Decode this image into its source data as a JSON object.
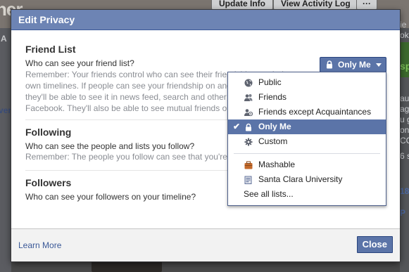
{
  "background": {
    "cover_title_fragment": "ner",
    "update_info_button": "Update Info",
    "activity_log_button": "View Activity Log",
    "more_button": "···",
    "left_fragment_a": "A",
    "left_fragment_ver": "ver",
    "right_fragments": [
      "ie",
      "ok.c",
      "sp",
      "aus",
      "ag",
      "u g",
      "ons",
      "CC",
      "6 s",
      "18",
      "P"
    ]
  },
  "dialog": {
    "title": "Edit Privacy",
    "sections": {
      "friend_list": {
        "heading": "Friend List",
        "question": "Who can see your friend list?",
        "remember": [
          "Remember: Your friends control who can see their friendships on their",
          "own timelines. If people can see your friendship on another timeline,",
          "they'll be able to see it in news feed, search and other places on",
          "Facebook. They'll also be able to see mutual friends on your timeline."
        ]
      },
      "following": {
        "heading": "Following",
        "question": "Who can see the people and lists you follow?",
        "remember": [
          "Remember: The people you follow can see that you're following them."
        ]
      },
      "followers": {
        "heading": "Followers",
        "question": "Who can see your followers on your timeline?"
      }
    },
    "footer": {
      "learn_more": "Learn More",
      "close": "Close"
    }
  },
  "privacy_selector": {
    "selected": "Only Me",
    "options": [
      {
        "label": "Public",
        "icon": "globe-icon"
      },
      {
        "label": "Friends",
        "icon": "friends-icon"
      },
      {
        "label": "Friends except Acquaintances",
        "icon": "friends-except-icon"
      },
      {
        "label": "Only Me",
        "icon": "lock-icon",
        "selected": true
      },
      {
        "label": "Custom",
        "icon": "gear-icon"
      }
    ],
    "lists": [
      {
        "label": "Mashable",
        "icon": "briefcase-icon"
      },
      {
        "label": "Santa Clara University",
        "icon": "school-icon"
      }
    ],
    "see_all": "See all lists..."
  },
  "colors": {
    "header_blue": "#6d84b4",
    "button_blue": "#5b74a8",
    "link_blue": "#3b5998"
  }
}
